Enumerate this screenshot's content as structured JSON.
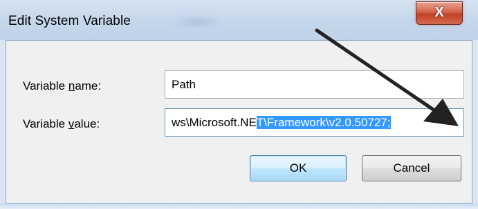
{
  "window": {
    "title": "Edit System Variable",
    "close_glyph": "X"
  },
  "form": {
    "name_label_pre": "Variable ",
    "name_label_accel": "n",
    "name_label_post": "ame:",
    "name_value": "Path",
    "value_label_pre": "Variable ",
    "value_label_accel": "v",
    "value_label_post": "alue:",
    "value_text_plain": "ws\\Microsoft.NE",
    "value_text_selected": "T\\Framework\\v2.0.50727;"
  },
  "buttons": {
    "ok_label": "OK",
    "cancel_label": "Cancel"
  },
  "colors": {
    "selection": "#3399ff",
    "close_button": "#c2402a",
    "annotation_arrow": "#222222"
  },
  "icons": {
    "close": "close-icon",
    "annotation": "arrow-annotation"
  }
}
